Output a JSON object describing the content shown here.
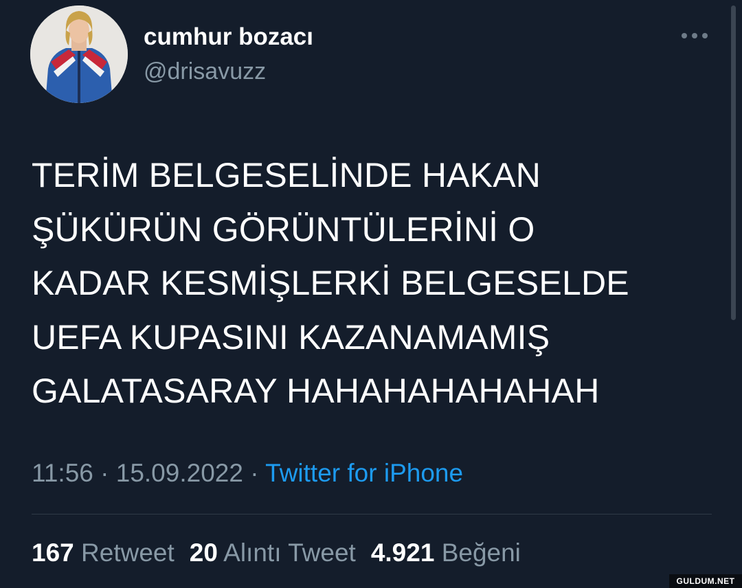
{
  "user": {
    "display_name": "cumhur bozacı",
    "handle": "@drisavuzz"
  },
  "tweet": {
    "lines": [
      "TERİM BELGESELİNDE HAKAN",
      "ŞÜKÜRÜN GÖRÜNTÜLERİNİ O",
      "KADAR KESMİŞLERKİ BELGESELDE",
      "UEFA KUPASINI KAZANAMAMIŞ",
      "GALATASARAY HAHAHAHAHAHAH"
    ],
    "time": "11:56",
    "separator": " · ",
    "date": "15.09.2022",
    "source": "Twitter for iPhone"
  },
  "stats": {
    "retweets_count": "167",
    "retweets_label": "Retweet",
    "quotes_count": "20",
    "quotes_label": "Alıntı Tweet",
    "likes_count": "4.921",
    "likes_label": "Beğeni"
  },
  "watermark": "GULDUM.NET",
  "icons": {
    "more": "more-horizontal-icon"
  },
  "colors": {
    "background": "#141d2b",
    "secondary_text": "#8899a6",
    "link": "#1d9bf0"
  }
}
